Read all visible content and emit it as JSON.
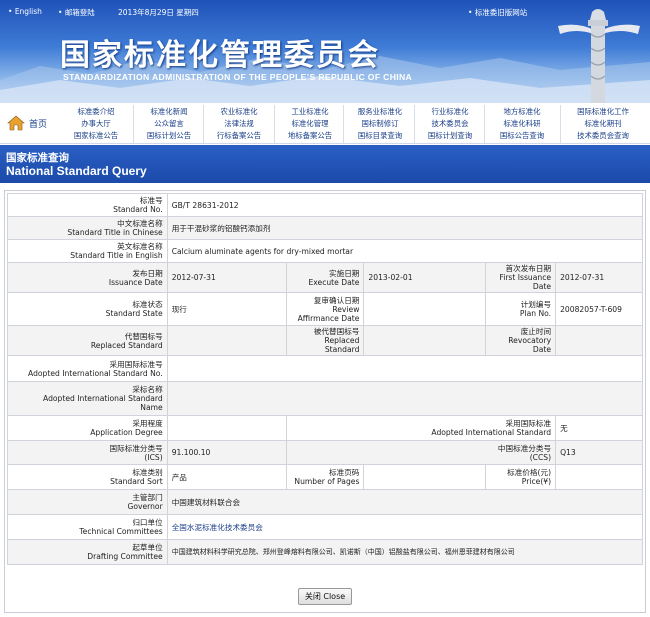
{
  "topbar": {
    "lang_link": "English",
    "mail_link": "邮箱登陆",
    "date_text": "2013年8月29日  星期四",
    "old_site_link": "标准委旧版网站"
  },
  "banner": {
    "title_cn": "国家标准化管理委员会",
    "title_en": "STANDARDIZATION ADMINISTRATION OF THE PEOPLE’S REPUBLIC OF CHINA"
  },
  "nav": {
    "home": "首页",
    "rows": [
      [
        "标准委介绍",
        "标准化新闻",
        "农业标准化",
        "工业标准化",
        "服务业标准化",
        "行业标准化",
        "地方标准化",
        "国际标准化工作"
      ],
      [
        "办事大厅",
        "公众留言",
        "法律法规",
        "标准化管理",
        "国标制修订",
        "技术委员会",
        "标准化科研",
        "标准化期刊"
      ],
      [
        "国家标准公告",
        "国标计划公告",
        "行标备案公告",
        "地标备案公告",
        "国标目录查询",
        "国标计划查询",
        "国标公告查询",
        "技术委员会查询"
      ]
    ]
  },
  "section": {
    "title_cn": "国家标准查询",
    "title_en": "National Standard Query"
  },
  "record": {
    "std_no_label_cn": "标准号",
    "std_no_label_en": "Standard No.",
    "std_no": "GB/T 28631-2012",
    "title_cn_label_cn": "中文标准名称",
    "title_cn_label_en": "Standard Title in Chinese",
    "title_cn": "用于干混砂浆的铝酸钙添加剂",
    "title_en_label_cn": "英文标准名称",
    "title_en_label_en": "Standard Title in English",
    "title_en": "Calcium aluminate agents for dry-mixed mortar",
    "issuance_label_cn": "发布日期",
    "issuance_label_en": "Issuance Date",
    "issuance": "2012-07-31",
    "execute_label_cn": "实施日期",
    "execute_label_en": "Execute Date",
    "execute": "2013-02-01",
    "first_issuance_label_cn": "首次发布日期",
    "first_issuance_label_en": "First Issuance Date",
    "first_issuance": "2012-07-31",
    "state_label_cn": "标准状态",
    "state_label_en": "Standard State",
    "state": "现行",
    "review_label_cn": "复审确认日期",
    "review_label_en": "Review Affirmance Date",
    "review": "",
    "plan_label_cn": "计划编号",
    "plan_label_en": "Plan No.",
    "plan": "20082057-T-609",
    "replaced_label_cn": "代替国标号",
    "replaced_label_en": "Replaced Standard",
    "replaced": "",
    "replaced_by_label_cn": "被代替国标号",
    "replaced_by_label_en": "Replaced Standard",
    "replaced_by": "",
    "revocatory_label_cn": "废止时间",
    "revocatory_label_en": "Revocatory Date",
    "revocatory": "",
    "adopted_no_label_cn": "采用国际标准号",
    "adopted_no_label_en": "Adopted International Standard No.",
    "adopted_no": "",
    "adopted_name_label_cn": "采标名称",
    "adopted_name_label_en1": "Adopted International Standard",
    "adopted_name_label_en2": "Name",
    "adopted_name": "",
    "degree_label_cn": "采用程度",
    "degree_label_en": "Application Degree",
    "degree": "",
    "adopted_std_label_cn": "采用国际标准",
    "adopted_std_label_en": "Adopted International Standard",
    "adopted_std": "无",
    "ics_label_cn": "国际标准分类号",
    "ics_label_en": "(ICS)",
    "ics": "91.100.10",
    "ccs_label_cn": "中国标准分类号",
    "ccs_label_en": "(CCS)",
    "ccs": "Q13",
    "sort_label_cn": "标准类别",
    "sort_label_en": "Standard Sort",
    "sort": "产品",
    "pages_label_cn": "标准页码",
    "pages_label_en": "Number of Pages",
    "pages": "",
    "price_label_cn": "标准价格(元)",
    "price_label_en": "Price(¥)",
    "price": "",
    "governor_label_cn": "主管部门",
    "governor_label_en": "Governor",
    "governor": "中国建筑材料联合会",
    "committee_label_cn": "归口单位",
    "committee_label_en": "Technical Committees",
    "committee": "全国水泥标准化技术委员会",
    "drafting_label_cn": "起草单位",
    "drafting_label_en": "Drafting Committee",
    "drafting": "中国建筑材料科学研究总院、郑州登峰熔料有限公司、凯诺斯（中国）铝酸盐有限公司、福州恩菲建材有限公司"
  },
  "close_button": "关闭 Close",
  "colors": {
    "banner_blue": "#1f52b8",
    "section_blue": "#1b4aa9",
    "nav_link": "#1a3e88"
  }
}
